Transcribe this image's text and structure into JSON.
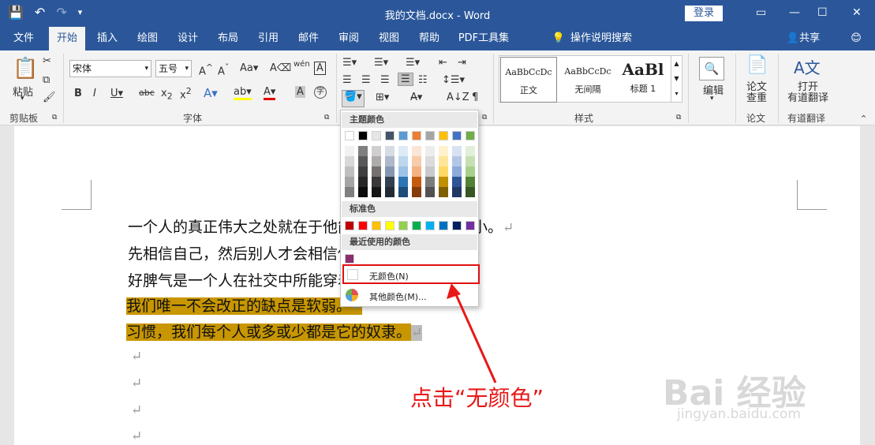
{
  "window": {
    "title": "我的文档.docx  -  Word",
    "login": "登录",
    "minimize": "—",
    "restore": "☐",
    "close": "✕"
  },
  "qat": {
    "save": "💾",
    "undo": "↶",
    "redo": "↷",
    "customize": "▾"
  },
  "tabs": [
    "文件",
    "开始",
    "插入",
    "绘图",
    "设计",
    "布局",
    "引用",
    "邮件",
    "审阅",
    "视图",
    "帮助",
    "PDF工具集"
  ],
  "tell_me": "操作说明搜索",
  "share": "共享",
  "ribbon": {
    "clipboard": {
      "paste": "粘贴",
      "label": "剪贴板"
    },
    "font": {
      "name": "宋体",
      "size": "五号",
      "label": "字体"
    },
    "styles": {
      "label": "样式",
      "cards": [
        {
          "preview": "AaBbCcDc",
          "name": "正文"
        },
        {
          "preview": "AaBbCcDc",
          "name": "无间隔"
        },
        {
          "preview": "AaBl",
          "name": "标题 1"
        }
      ]
    },
    "edit": {
      "label": "编辑"
    },
    "paper": {
      "btn": "论文\n查重",
      "label": "论文"
    },
    "translate": {
      "btn": "打开\n有道翻译",
      "label": "有道翻译"
    }
  },
  "document": {
    "lines": [
      "一个人的真正伟大之处就在于他能够认识到自己的渺小。",
      "先相信自己，然后别人才会相信你。",
      "好脾气是一个人在社交中所能穿着的最佳服饰。",
      "我们唯一不会改正的缺点是软弱。",
      "习惯，我们每个人或多或少都是它的奴隶。"
    ],
    "return_mark": "↵"
  },
  "dropdown": {
    "theme_colors_label": "主题颜色",
    "standard_colors_label": "标准色",
    "recent_colors_label": "最近使用的颜色",
    "no_color": "无颜色(N)",
    "more_colors": "其他颜色(M)...",
    "theme_top": [
      "#ffffff",
      "#000000",
      "#e7e6e6",
      "#44546a",
      "#5b9bd5",
      "#ed7d31",
      "#a5a5a5",
      "#ffc000",
      "#4472c4",
      "#70ad47"
    ],
    "theme_shades": [
      [
        "#f2f2f2",
        "#7f7f7f",
        "#d0cece",
        "#d6dce4",
        "#deebf6",
        "#fbe5d5",
        "#ededed",
        "#fff2cc",
        "#d9e2f3",
        "#e2efd9"
      ],
      [
        "#d8d8d8",
        "#595959",
        "#aeabab",
        "#adb9ca",
        "#bdd7ee",
        "#f7cbac",
        "#dbdbdb",
        "#fee599",
        "#b4c6e7",
        "#c5e0b3"
      ],
      [
        "#bfbfbf",
        "#3f3f3f",
        "#757070",
        "#8496b0",
        "#9dc3e6",
        "#f4b183",
        "#c9c9c9",
        "#ffd965",
        "#8eaadb",
        "#a8d08d"
      ],
      [
        "#a5a5a5",
        "#262626",
        "#3a3838",
        "#323f4f",
        "#2e75b5",
        "#c55a11",
        "#7b7b7b",
        "#bf9000",
        "#2f5496",
        "#538135"
      ],
      [
        "#7f7f7f",
        "#0c0c0c",
        "#171616",
        "#222a35",
        "#1e4d78",
        "#833c0b",
        "#525252",
        "#7f6000",
        "#1f3864",
        "#375623"
      ]
    ],
    "standard": [
      "#c00000",
      "#ff0000",
      "#ffc000",
      "#ffff00",
      "#92d050",
      "#00b050",
      "#00b0f0",
      "#0070c0",
      "#002060",
      "#7030a0"
    ],
    "recent": [
      "#8b2f6e"
    ]
  },
  "annotation": "点击“无颜色”",
  "watermark": {
    "brand": "Bai 经验",
    "url": "jingyan.baidu.com"
  }
}
